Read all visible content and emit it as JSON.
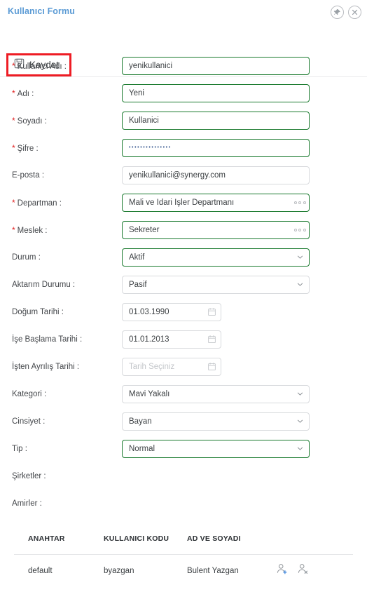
{
  "window": {
    "title": "Kullanıcı Formu",
    "pin_icon": "pin-icon",
    "close_icon": "close-icon"
  },
  "toolbar": {
    "save_label": "Kaydet",
    "save_icon": "save-disk-icon",
    "highlight_color": "#ee1c24"
  },
  "colors": {
    "title": "#5b9bd5",
    "required": "#e02020",
    "valid_border": "#1a7a2e",
    "default_border": "#d8dadd",
    "text": "#3c4043"
  },
  "form": {
    "fields": [
      {
        "name": "kullanici-adi",
        "label": "Kullanıcı Adı :",
        "required": true,
        "value": "yenikullanici",
        "control": "text",
        "state": "valid"
      },
      {
        "name": "adi",
        "label": "Adı :",
        "required": true,
        "value": "Yeni",
        "control": "text",
        "state": "valid"
      },
      {
        "name": "soyadi",
        "label": "Soyadı :",
        "required": true,
        "value": "Kullanici",
        "control": "text",
        "state": "valid"
      },
      {
        "name": "sifre",
        "label": "Şifre :",
        "required": true,
        "value": "•••••••••••••••",
        "control": "password",
        "state": "valid"
      },
      {
        "name": "e-posta",
        "label": "E-posta :",
        "required": false,
        "value": "yenikullanici@synergy.com",
        "control": "text",
        "state": "default"
      },
      {
        "name": "departman",
        "label": "Departman :",
        "required": true,
        "value": "Mali ve İdari İşler Departmanı",
        "control": "lookup",
        "state": "valid"
      },
      {
        "name": "meslek",
        "label": "Meslek :",
        "required": true,
        "value": "Sekreter",
        "control": "lookup",
        "state": "valid"
      },
      {
        "name": "durum",
        "label": "Durum :",
        "required": false,
        "value": "Aktif",
        "control": "select",
        "state": "valid"
      },
      {
        "name": "aktarim-durumu",
        "label": "Aktarım Durumu :",
        "required": false,
        "value": "Pasif",
        "control": "select",
        "state": "default"
      },
      {
        "name": "dogum-tarihi",
        "label": "Doğum Tarihi :",
        "required": false,
        "value": "01.03.1990",
        "control": "date",
        "state": "default"
      },
      {
        "name": "ise-baslama-tarihi",
        "label": "İşe Başlama Tarihi :",
        "required": false,
        "value": "01.01.2013",
        "control": "date",
        "state": "default"
      },
      {
        "name": "isten-ayrilis-tarihi",
        "label": "İşten Ayrılış Tarihi :",
        "required": false,
        "value": "",
        "placeholder": "Tarih Seçiniz",
        "control": "date",
        "state": "default"
      },
      {
        "name": "kategori",
        "label": "Kategori :",
        "required": false,
        "value": "Mavi Yakalı",
        "control": "select",
        "state": "default"
      },
      {
        "name": "cinsiyet",
        "label": "Cinsiyet :",
        "required": false,
        "value": "Bayan",
        "control": "select",
        "state": "default"
      },
      {
        "name": "tip",
        "label": "Tip :",
        "required": false,
        "value": "Normal",
        "control": "select",
        "state": "valid"
      },
      {
        "name": "sirketler",
        "label": "Şirketler :",
        "required": false,
        "value": "",
        "control": "none",
        "state": "default"
      },
      {
        "name": "amirler",
        "label": "Amirler :",
        "required": false,
        "value": "",
        "control": "none",
        "state": "default"
      }
    ]
  },
  "grid": {
    "columns": [
      "ANAHTAR",
      "KULLANICI KODU",
      "AD VE SOYADI"
    ],
    "rows": [
      {
        "anahtar": "default",
        "kullanici_kodu": "byazgan",
        "ad_ve_soyadi": "Bulent Yazgan",
        "actions": [
          "add-user-icon",
          "remove-user-icon"
        ]
      }
    ]
  }
}
